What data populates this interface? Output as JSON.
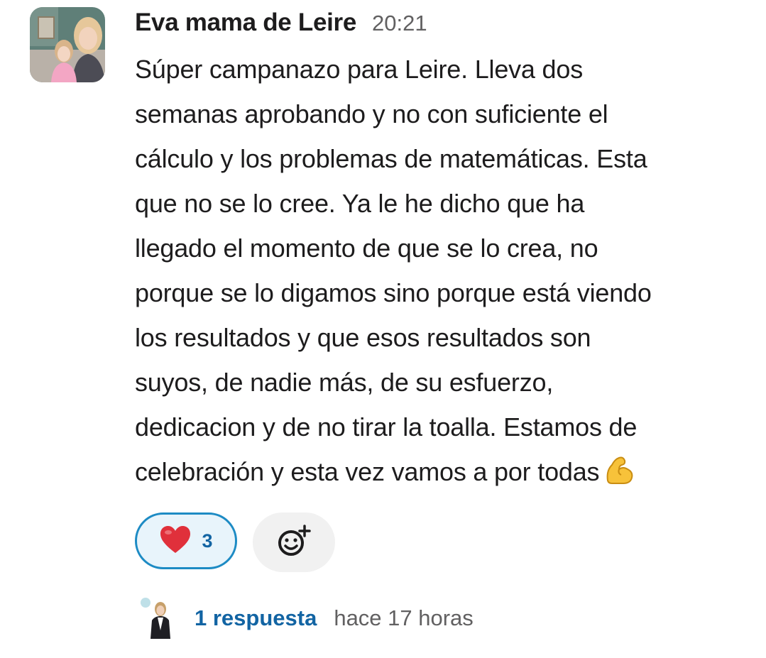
{
  "message": {
    "author": "Eva mama de Leire",
    "time": "20:21",
    "lines": [
      "Súper campanazo para Leire. Lleva dos",
      "semanas aprobando y no con suficiente el",
      "cálculo y los problemas de matemáticas. Esta",
      "que no se lo cree. Ya le he dicho que ha",
      "llegado el momento de que se lo crea, no",
      "porque se lo digamos sino porque está viendo",
      "los resultados y que esos resultados son",
      "suyos, de nadie más, de su esfuerzo,",
      "dedicacion y de no tirar la toalla. Estamos de",
      "celebración y esta vez vamos a por todas"
    ],
    "trailing_emoji": "flexed-biceps-icon"
  },
  "reactions": [
    {
      "icon": "red-heart-icon",
      "count": "3",
      "selected": true
    }
  ],
  "add_reaction_icon": "add-emoji-icon",
  "thread": {
    "reply_count_label": "1 respuesta",
    "last_reply_label": "hace 17 horas"
  },
  "colors": {
    "link": "#1264a3",
    "reaction_border": "#1d8bc4",
    "reaction_bg": "#e8f4fb",
    "muted": "#616061"
  }
}
